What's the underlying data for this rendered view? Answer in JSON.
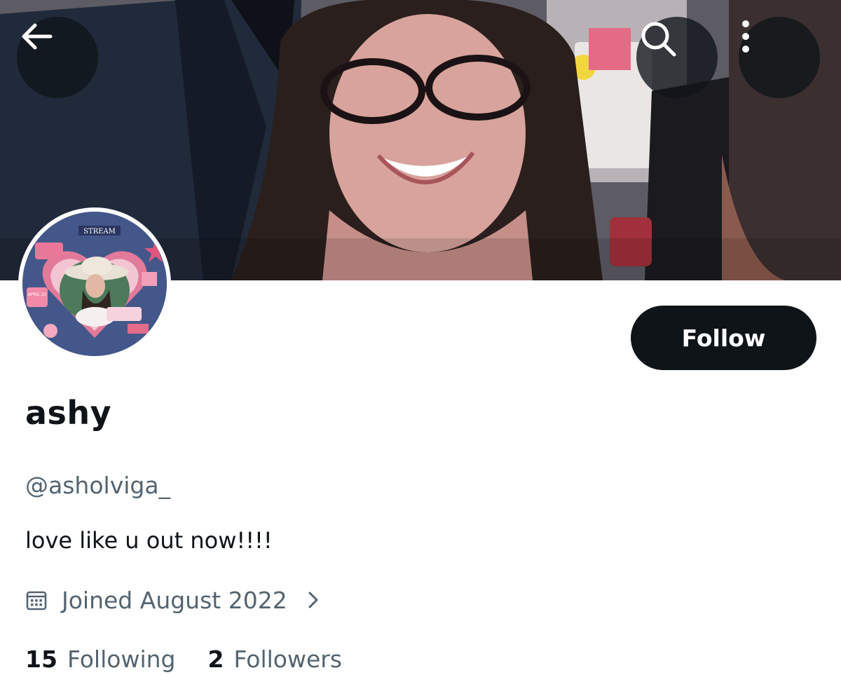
{
  "header": {
    "back_icon": "arrow-left-icon",
    "search_icon": "search-icon",
    "more_icon": "more-vertical-icon"
  },
  "profile": {
    "display_name": "ashy",
    "handle": "@asholviga_",
    "bio": "love like u out now!!!!",
    "joined": "Joined August 2022",
    "following_count": "15",
    "following_label": "Following",
    "followers_count": "2",
    "followers_label": "Followers"
  },
  "avatar_art": {
    "stream_label": "STREAM",
    "date_label": "APRIL 22"
  },
  "actions": {
    "follow_label": "Follow"
  },
  "colors": {
    "primary_text": "#0f1419",
    "secondary_text": "#536471",
    "button_bg": "#0f1419",
    "button_text": "#ffffff",
    "overlay_button": "rgba(15,20,25,0.78)"
  }
}
